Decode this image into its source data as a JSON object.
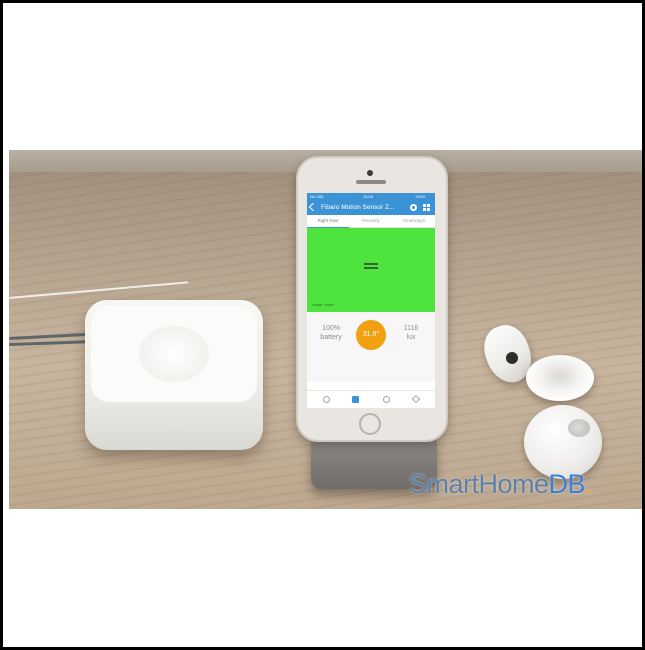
{
  "watermark": {
    "part1": "SmartHome",
    "part2": "DB",
    "dot": "."
  },
  "phone_screen": {
    "status": {
      "carrier": "No SIM",
      "time": "16:06",
      "battery": "100%"
    },
    "app_title": "Fibaro Motion Sensor Z...",
    "tabs": [
      {
        "label": "Right Now",
        "active": true
      },
      {
        "label": "Recently",
        "active": false
      },
      {
        "label": "SmartApps",
        "active": false
      }
    ],
    "motion_panel": {
      "color": "#4fe340",
      "caption": "Tamper: active"
    },
    "stats": {
      "battery_value": "100%",
      "battery_label": "battery",
      "temperature": "31.9°",
      "lux_value": "1116",
      "lux_label": "lux"
    },
    "bottom_nav_icons": [
      "dashboard-icon",
      "things-icon",
      "smartapps-icon",
      "marketplace-icon"
    ]
  },
  "colors": {
    "accent_blue": "#3b93d6",
    "temperature_orange": "#f1a012"
  }
}
